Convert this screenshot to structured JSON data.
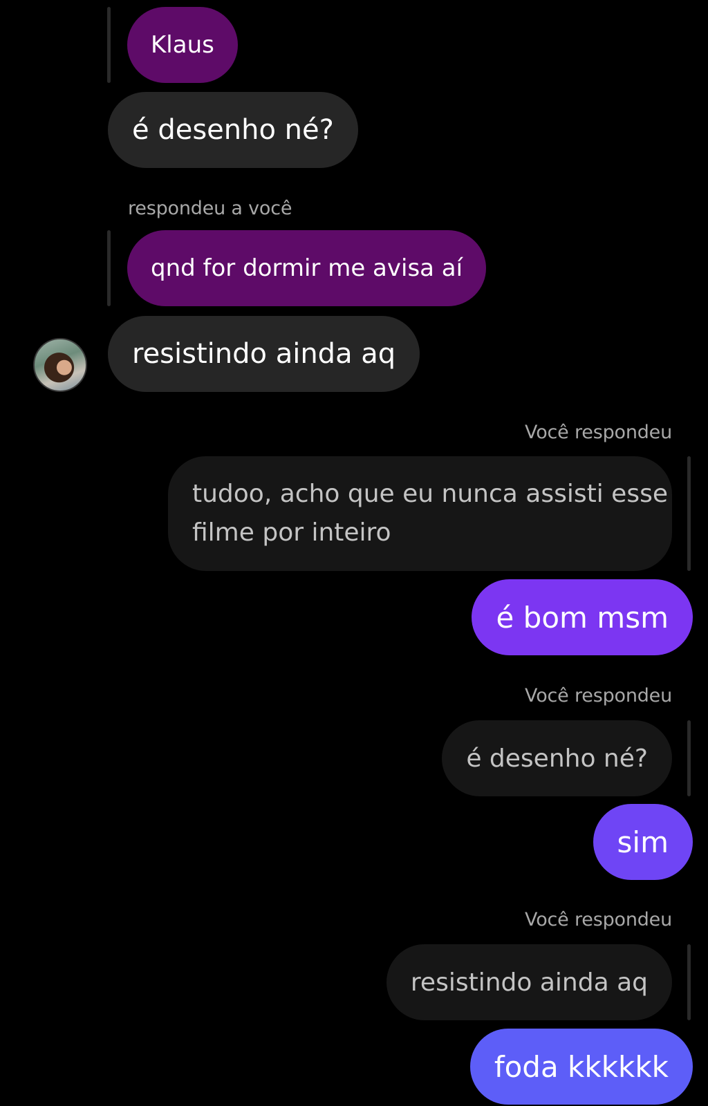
{
  "colors": {
    "background": "#000000",
    "received_bubble": "#262626",
    "quoted_received": "#5e0b68",
    "quoted_sent": "#161616",
    "sent_gradient_top": "#7d34f2",
    "sent_gradient_bottom": "#5d5ef8",
    "reply_label": "#a8a8a8"
  },
  "messages": {
    "m1": {
      "quoted_text": "Klaus",
      "text": "é desenho né?"
    },
    "m2": {
      "reply_label": "respondeu a você",
      "quoted_text": "qnd for dormir me avisa aí",
      "text": "resistindo ainda aq",
      "avatar_icon": "contact-avatar"
    },
    "m3": {
      "reply_label": "Você respondeu",
      "quoted_text_line1": "tudoo, acho que eu nunca assisti esse",
      "quoted_text_line2": "filme por inteiro",
      "text": "é bom msm"
    },
    "m4": {
      "reply_label": "Você respondeu",
      "quoted_text": "é desenho né?",
      "text": "sim"
    },
    "m5": {
      "reply_label": "Você respondeu",
      "quoted_text": "resistindo ainda aq",
      "text": "foda kkkkkk"
    }
  }
}
